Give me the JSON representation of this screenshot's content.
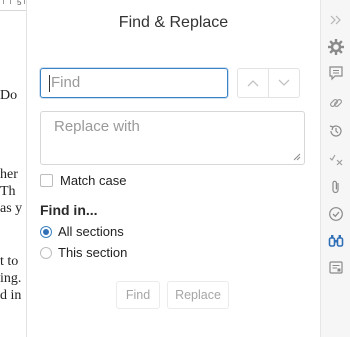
{
  "document": {
    "ruler_number": "5",
    "lines": [
      "Do",
      "her",
      "Th",
      "as y",
      "t to",
      "ing.",
      "d in"
    ]
  },
  "dialog": {
    "title": "Find & Replace",
    "find_placeholder": "Find",
    "replace_placeholder": "Replace with",
    "match_case_label": "Match case",
    "find_in_heading": "Find in...",
    "scope_options": [
      {
        "label": "All sections",
        "selected": true
      },
      {
        "label": "This section",
        "selected": false
      }
    ],
    "find_button": "Find",
    "replace_button": "Replace"
  },
  "rail": {
    "icons": [
      "collapse-icon",
      "gear-icon",
      "comment-icon",
      "link-icon",
      "history-icon",
      "spellcheck-icon",
      "attachment-icon",
      "check-circle-icon",
      "binoculars-icon",
      "preview-icon"
    ],
    "accent": "#2f6fb8"
  }
}
